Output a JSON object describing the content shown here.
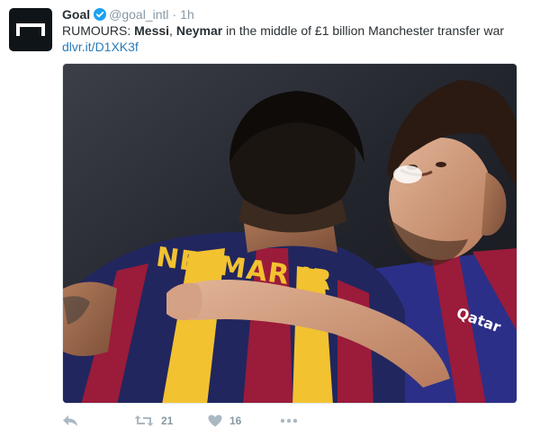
{
  "tweet": {
    "account_name": "Goal",
    "handle": "@goal_intl",
    "separator": "·",
    "time": "1h",
    "text_prefix": "RUMOURS: ",
    "text_bold_1": "Messi",
    "text_mid": ", ",
    "text_bold_2": "Neymar",
    "text_suffix": " in the middle of £1 billion Manchester transfer war",
    "link": "dlvr.it/D1XK3f",
    "jersey_name": "NEYMAR JR",
    "shirt_sponsor": "Qatar",
    "retweet_count": "21",
    "like_count": "16"
  },
  "icons": {
    "avatar": "goal-logo-icon",
    "verified": "verified-badge-icon",
    "reply": "reply-icon",
    "retweet": "retweet-icon",
    "like": "heart-icon",
    "more": "more-icon"
  },
  "colors": {
    "link": "#2b7bb9",
    "verified": "#1da1f2",
    "meta": "#8899a6",
    "avatar_bg": "#0f1419"
  }
}
